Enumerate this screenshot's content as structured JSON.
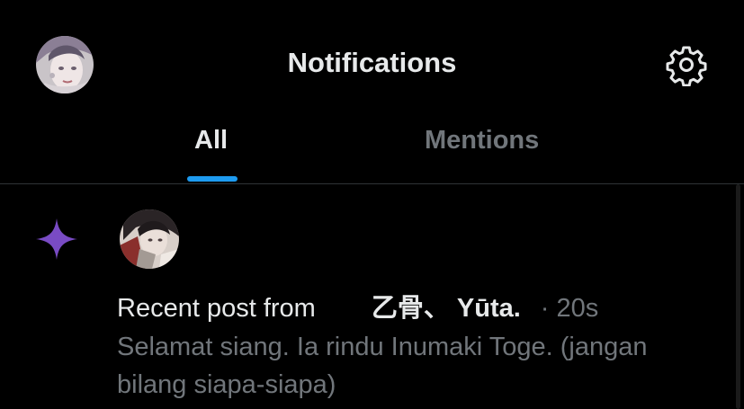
{
  "header": {
    "title": "Notifications",
    "avatar_icon": "user-avatar",
    "settings_icon": "gear-icon"
  },
  "tabs": [
    {
      "label": "All",
      "active": true
    },
    {
      "label": "Mentions",
      "active": false
    }
  ],
  "notifications": [
    {
      "type_icon": "sparkle-icon",
      "type_icon_color": "#794bc4",
      "prefix": "Recent post from",
      "author": "乙骨、 Yūta.",
      "time": "· 20s",
      "body": "Selamat siang. Ia rindu Inumaki Toge. (jangan bilang siapa-siapa)"
    }
  ],
  "colors": {
    "background": "#000000",
    "text_primary": "#e7e9ea",
    "text_secondary": "#71767b",
    "accent": "#1d9bf0",
    "divider": "#2f3336"
  }
}
